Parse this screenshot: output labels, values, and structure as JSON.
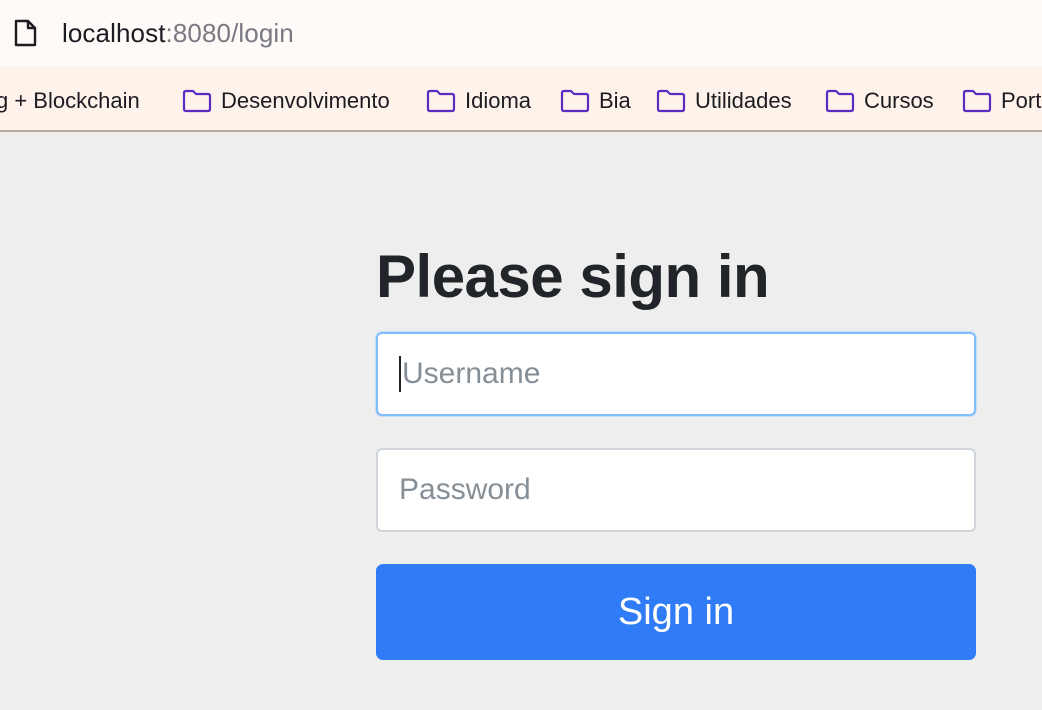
{
  "address_bar": {
    "host": "localhost",
    "path": ":8080/login",
    "page_icon": "page-icon"
  },
  "bookmarks": [
    {
      "label": "g + Blockchain",
      "icon": null
    },
    {
      "label": "Desenvolvimento",
      "icon": "folder-icon"
    },
    {
      "label": "Idioma",
      "icon": "folder-icon"
    },
    {
      "label": "Bia",
      "icon": "folder-icon"
    },
    {
      "label": "Utilidades",
      "icon": "folder-icon"
    },
    {
      "label": "Cursos",
      "icon": "folder-icon"
    },
    {
      "label": "Port",
      "icon": "folder-icon"
    }
  ],
  "login": {
    "heading": "Please sign in",
    "username": {
      "placeholder": "Username",
      "value": ""
    },
    "password": {
      "placeholder": "Password",
      "value": ""
    },
    "submit_label": "Sign in"
  },
  "colors": {
    "primary": "#2f7cf6",
    "folder": "#5b2bc4",
    "focus_border": "#80bdff"
  }
}
